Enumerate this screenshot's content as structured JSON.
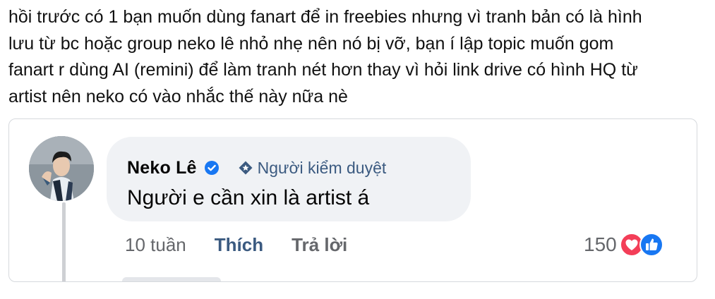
{
  "post": {
    "lines": [
      "hồi trước có 1 bạn muốn dùng fanart để in freebies nhưng vì tranh bản có là hình",
      "lưu từ bc hoặc group neko lê nhỏ nhẹ nên nó bị vỡ, bạn í lập topic muốn gom",
      "fanart r dùng AI (remini) để làm tranh nét hơn thay vì hỏi link drive có hình HQ từ",
      "artist nên neko có vào nhắc thế này nữa nè"
    ]
  },
  "comment": {
    "author": "Neko Lê",
    "badge": "Người kiểm duyệt",
    "text": "Người e cần xin là artist á",
    "time": "10 tuần",
    "like_label": "Thích",
    "reply_label": "Trả lời",
    "reaction_count": "150",
    "reaction_icons": [
      "love-reaction-icon",
      "like-reaction-icon"
    ]
  },
  "colors": {
    "verified": "#1877f2",
    "moderator": "#3b5a80",
    "love": "#f33e58",
    "like": "#1877f2",
    "bubble": "#f0f2f5"
  }
}
